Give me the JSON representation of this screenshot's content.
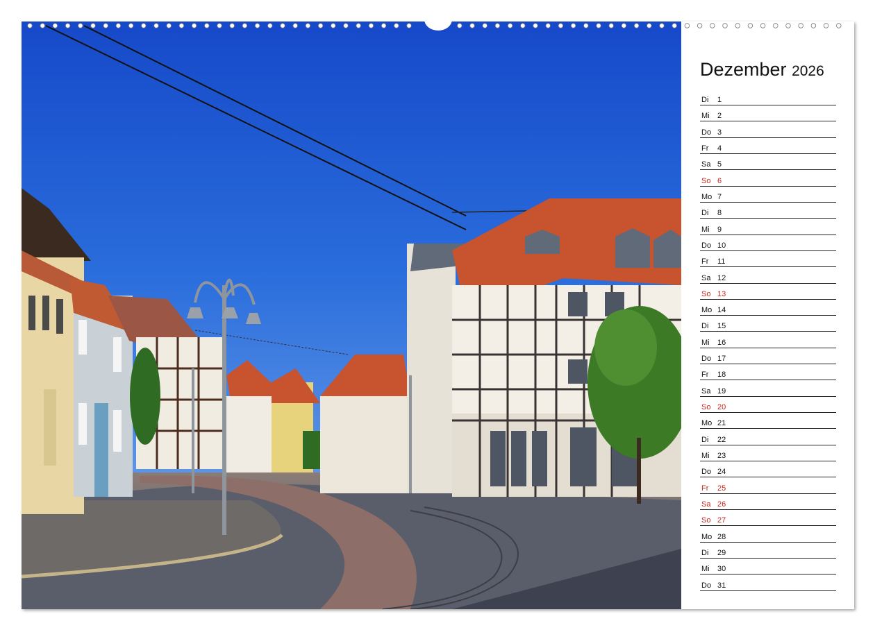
{
  "calendar": {
    "month": "Dezember",
    "year": "2026",
    "days": [
      {
        "weekday": "Di",
        "day": "1",
        "red": false
      },
      {
        "weekday": "Mi",
        "day": "2",
        "red": false
      },
      {
        "weekday": "Do",
        "day": "3",
        "red": false
      },
      {
        "weekday": "Fr",
        "day": "4",
        "red": false
      },
      {
        "weekday": "Sa",
        "day": "5",
        "red": false
      },
      {
        "weekday": "So",
        "day": "6",
        "red": true
      },
      {
        "weekday": "Mo",
        "day": "7",
        "red": false
      },
      {
        "weekday": "Di",
        "day": "8",
        "red": false
      },
      {
        "weekday": "Mi",
        "day": "9",
        "red": false
      },
      {
        "weekday": "Do",
        "day": "10",
        "red": false
      },
      {
        "weekday": "Fr",
        "day": "11",
        "red": false
      },
      {
        "weekday": "Sa",
        "day": "12",
        "red": false
      },
      {
        "weekday": "So",
        "day": "13",
        "red": true
      },
      {
        "weekday": "Mo",
        "day": "14",
        "red": false
      },
      {
        "weekday": "Di",
        "day": "15",
        "red": false
      },
      {
        "weekday": "Mi",
        "day": "16",
        "red": false
      },
      {
        "weekday": "Do",
        "day": "17",
        "red": false
      },
      {
        "weekday": "Fr",
        "day": "18",
        "red": false
      },
      {
        "weekday": "Sa",
        "day": "19",
        "red": false
      },
      {
        "weekday": "So",
        "day": "20",
        "red": true
      },
      {
        "weekday": "Mo",
        "day": "21",
        "red": false
      },
      {
        "weekday": "Di",
        "day": "22",
        "red": false
      },
      {
        "weekday": "Mi",
        "day": "23",
        "red": false
      },
      {
        "weekday": "Do",
        "day": "24",
        "red": false
      },
      {
        "weekday": "Fr",
        "day": "25",
        "red": true
      },
      {
        "weekday": "Sa",
        "day": "26",
        "red": true
      },
      {
        "weekday": "So",
        "day": "27",
        "red": true
      },
      {
        "weekday": "Mo",
        "day": "28",
        "red": false
      },
      {
        "weekday": "Di",
        "day": "29",
        "red": false
      },
      {
        "weekday": "Mi",
        "day": "30",
        "red": false
      },
      {
        "weekday": "Do",
        "day": "31",
        "red": false
      }
    ]
  },
  "colors": {
    "holiday": "#c9251d",
    "text": "#111111",
    "sky": "#1f5fd4",
    "roof": "#c8532f"
  },
  "photo": {
    "icon": "half-timbered-street-photo"
  }
}
